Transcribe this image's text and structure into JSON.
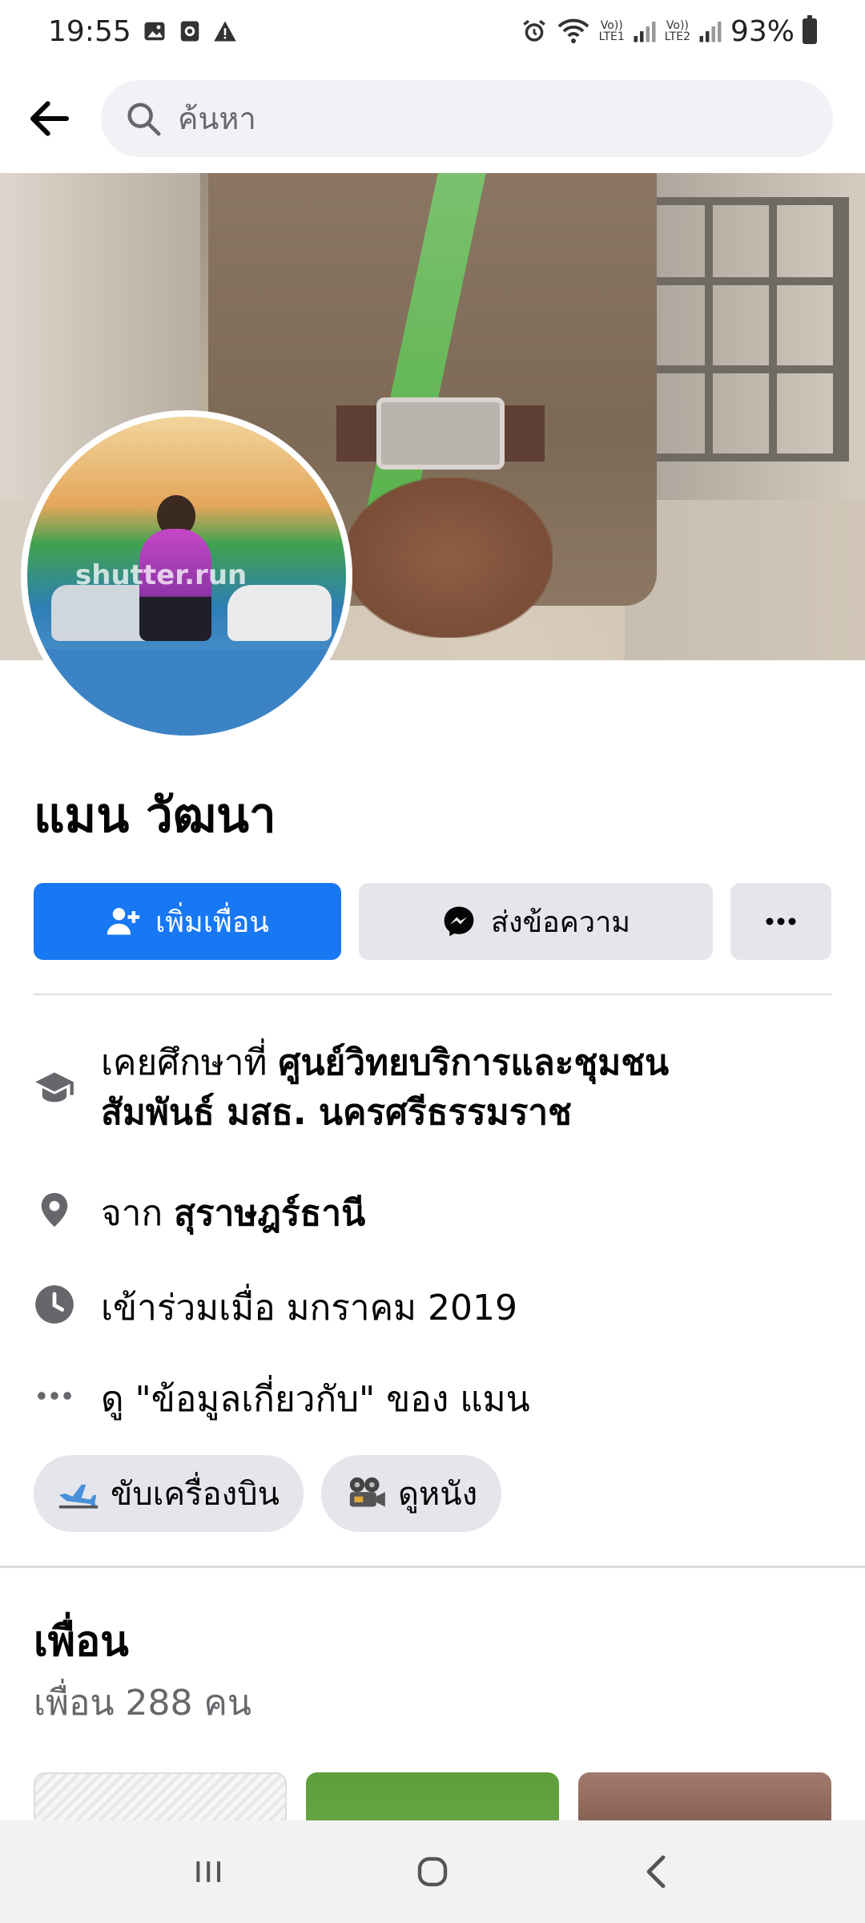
{
  "status_bar": {
    "time": "19:55",
    "left_icons": [
      "gallery-icon",
      "screen-record-icon",
      "warning-icon"
    ],
    "right_icons": [
      "alarm-icon",
      "wifi-icon",
      "signal-sim1-icon",
      "signal-sim2-icon",
      "battery-icon"
    ],
    "sim1_label_top": "Vo))",
    "sim1_label_bottom": "LTE1",
    "sim2_label_top": "Vo))",
    "sim2_label_bottom": "LTE2",
    "battery": "93%"
  },
  "header": {
    "back_icon": "arrow-left-icon",
    "search_icon": "search-icon",
    "search_placeholder": "ค้นหา"
  },
  "profile": {
    "name": "แมน วัฒนา",
    "avatar_watermark": "shutter.run"
  },
  "actions": {
    "add_friend_label": "เพิ่มเพื่อน",
    "message_label": "ส่งข้อความ",
    "more_label": "···"
  },
  "info": {
    "education_prefix": "เคยศึกษาที่",
    "education_place_line1": "ศูนย์วิทยบริการและชุมชน",
    "education_place_line2": "สัมพันธ์ มสธ. นครศรีธรรมราช",
    "from_prefix": "จาก",
    "from_place": "สุราษฎร์ธานี",
    "joined": "เข้าร่วมเมื่อ มกราคม  2019",
    "about_link": "ดู \"ข้อมูลเกี่ยวกับ\" ของ แมน"
  },
  "hobbies": [
    {
      "label": "ขับเครื่องบิน",
      "icon": "airplane-icon"
    },
    {
      "label": "ดูหนัง",
      "icon": "movie-camera-icon"
    }
  ],
  "friends": {
    "title": "เพื่อน",
    "count_text": "เพื่อน 288 คน"
  },
  "nav": {
    "recents_icon": "recents-icon",
    "home_icon": "home-icon",
    "back_icon": "back-chevron-icon"
  },
  "colors": {
    "brand_blue": "#1877f2",
    "secondary_button": "#e4e6eb",
    "muted_text": "#65676b",
    "search_bg": "#f0f2f5"
  }
}
